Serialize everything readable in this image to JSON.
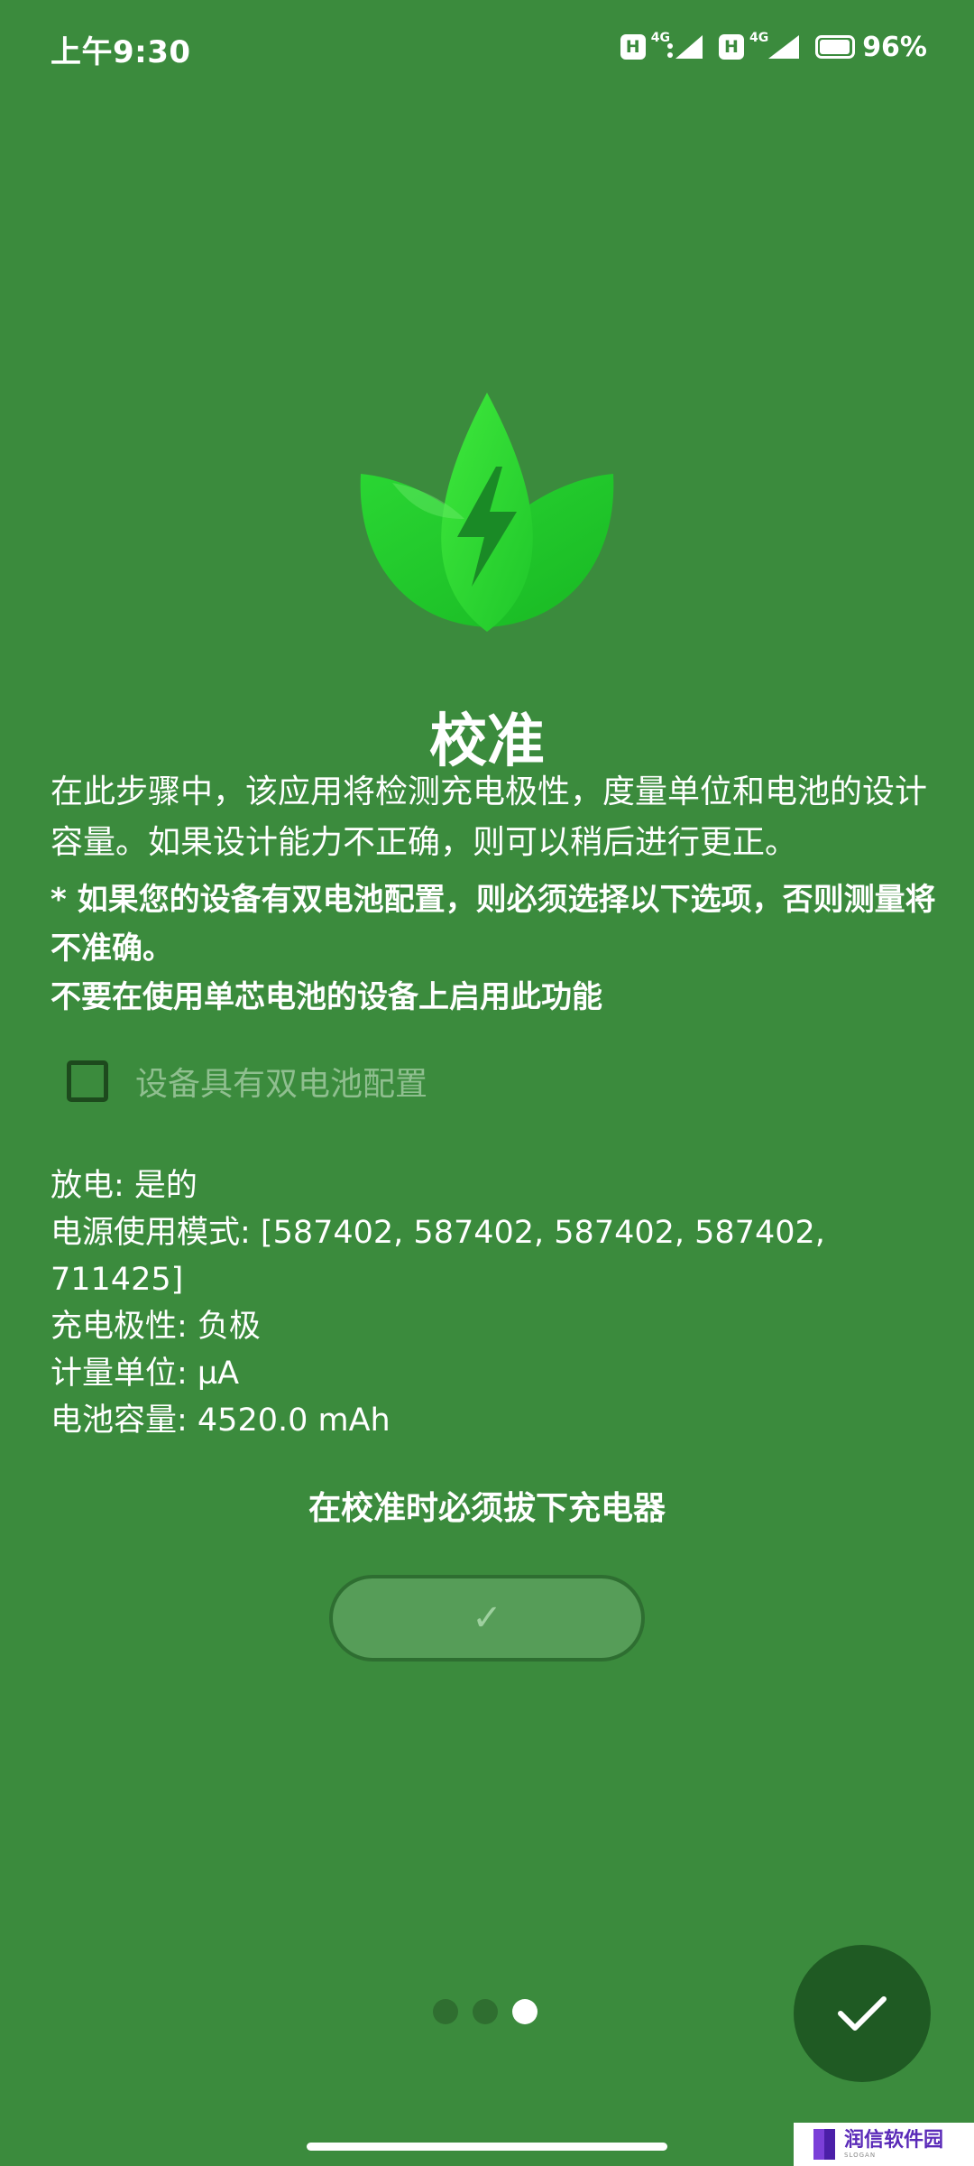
{
  "status_bar": {
    "time": "上午9:30",
    "sim1": {
      "hd": "H",
      "network": "4G"
    },
    "sim2": {
      "hd": "H",
      "network": "4G"
    },
    "battery_percent": "96%",
    "battery_level": 0.96
  },
  "screen": {
    "title": "校准",
    "description": "在此步骤中，该应用将检测充电极性，度量单位和电池的设计容量。如果设计能力不正确，则可以稍后进行更正。",
    "warning": [
      "* 如果您的设备有双电池配置，则必须选择以下选项，否则测量将不准确。",
      "不要在使用单芯电池的设备上启用此功能"
    ],
    "dual_battery_checkbox": {
      "label": "设备具有双电池配置",
      "checked": false
    },
    "info": [
      "放电: 是的",
      "电源使用模式: [587402, 587402, 587402, 587402, 711425]",
      "充电极性: 负极",
      "计量单位: µA",
      "电池容量: 4520.0 mAh"
    ],
    "unplug_notice": "在校准时必须拔下充电器",
    "confirm_button_label": "✓"
  },
  "pager": {
    "total": 3,
    "active": 3
  },
  "fab_icon": "checkmark-icon",
  "watermark": {
    "name": "润信软件园",
    "sub": "SLOGAN"
  },
  "colors": {
    "background": "#3b8b3d",
    "fab": "#1f5a23",
    "button": "#569d58",
    "accent_leaf": "#22d22d"
  }
}
